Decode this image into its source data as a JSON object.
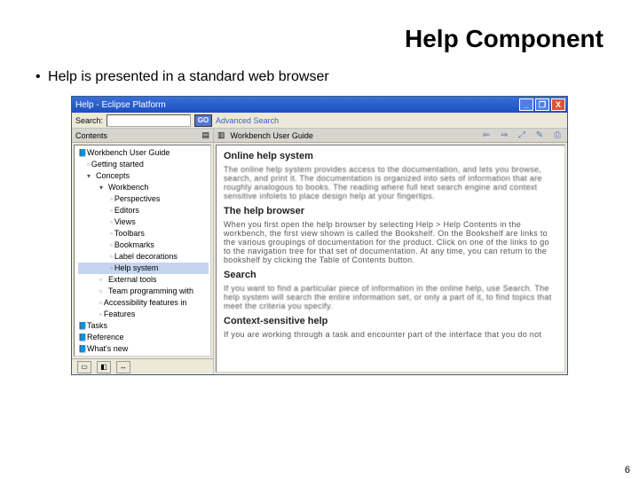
{
  "slide": {
    "title": "Help Component",
    "bullet": "Help is presented in a standard web browser",
    "pagenum": "6"
  },
  "window": {
    "title": "Help - Eclipse Platform",
    "minimize": "_",
    "maximize": "❐",
    "close": "X"
  },
  "toolbar": {
    "search_label": "Search:",
    "search_placeholder": "",
    "go_label": "GO",
    "advanced_label": "Advanced Search"
  },
  "sidebar": {
    "title": "Contents",
    "corner_icon": "▤",
    "items": [
      {
        "cls": "twisty ic-book",
        "ind": "",
        "label": "Workbench User Guide"
      },
      {
        "cls": "ic-page",
        "ind": "ind1",
        "label": "Getting started"
      },
      {
        "cls": "twisty-open",
        "ind": "ind1",
        "label": "Concepts"
      },
      {
        "cls": "twisty-open",
        "ind": "ind2",
        "label": "Workbench"
      },
      {
        "cls": "ic-page",
        "ind": "ind3",
        "label": "Perspectives"
      },
      {
        "cls": "ic-page",
        "ind": "ind3",
        "label": "Editors"
      },
      {
        "cls": "ic-page",
        "ind": "ind3",
        "label": "Views"
      },
      {
        "cls": "ic-page",
        "ind": "ind3",
        "label": "Toolbars"
      },
      {
        "cls": "ic-page",
        "ind": "ind3",
        "label": "Bookmarks"
      },
      {
        "cls": "ic-page",
        "ind": "ind3",
        "label": "Label decorations"
      },
      {
        "cls": "ic-page sel",
        "ind": "ind3",
        "label": "Help system"
      },
      {
        "cls": "twisty ic-page",
        "ind": "ind2",
        "label": "External tools"
      },
      {
        "cls": "twisty ic-page",
        "ind": "ind2",
        "label": "Team programming with"
      },
      {
        "cls": "ic-page",
        "ind": "ind2",
        "label": "Accessibility features in"
      },
      {
        "cls": "ic-page",
        "ind": "ind2",
        "label": "Features"
      },
      {
        "cls": "twisty ic-book",
        "ind": "",
        "label": "Tasks"
      },
      {
        "cls": "twisty ic-book",
        "ind": "",
        "label": "Reference"
      },
      {
        "cls": "twisty ic-book",
        "ind": "",
        "label": "What's new"
      }
    ],
    "bottom": {
      "b1": "▭",
      "b2": "◧",
      "b3": "↔"
    }
  },
  "content": {
    "breadcrumb_icon": "▥",
    "breadcrumb": "Workbench User Guide",
    "nav": {
      "back": "⇐",
      "fwd": "⇒",
      "sync": "⤢",
      "bookmark": "✎",
      "print": "⎙"
    },
    "h1": "Online help system",
    "p1": "The online help system provides access to the documentation, and lets you browse, search, and print it. The documentation is organized into sets of information that are roughly analogous to books. The reading where full text search engine and context sensitive infolets to place design help at your fingertips.",
    "h2": "The help browser",
    "p2": "When you first open the help browser by selecting Help > Help Contents in the workbench, the first view shown is called the Bookshelf. On the Bookshelf are links to the various groupings of documentation for the product. Click on one of the links to go to the navigation tree for that set of documentation. At any time, you can return to the bookshelf by clicking the Table of Contents button.",
    "h3": "Search",
    "p3": "If you want to find a particular piece of information in the online help, use Search. The help system will search the entire information set, or only a part of it, to find topics that meet the criteria you specify.",
    "h4": "Context-sensitive help",
    "p4": "If you are working through a task and encounter part of the interface that you do not"
  }
}
